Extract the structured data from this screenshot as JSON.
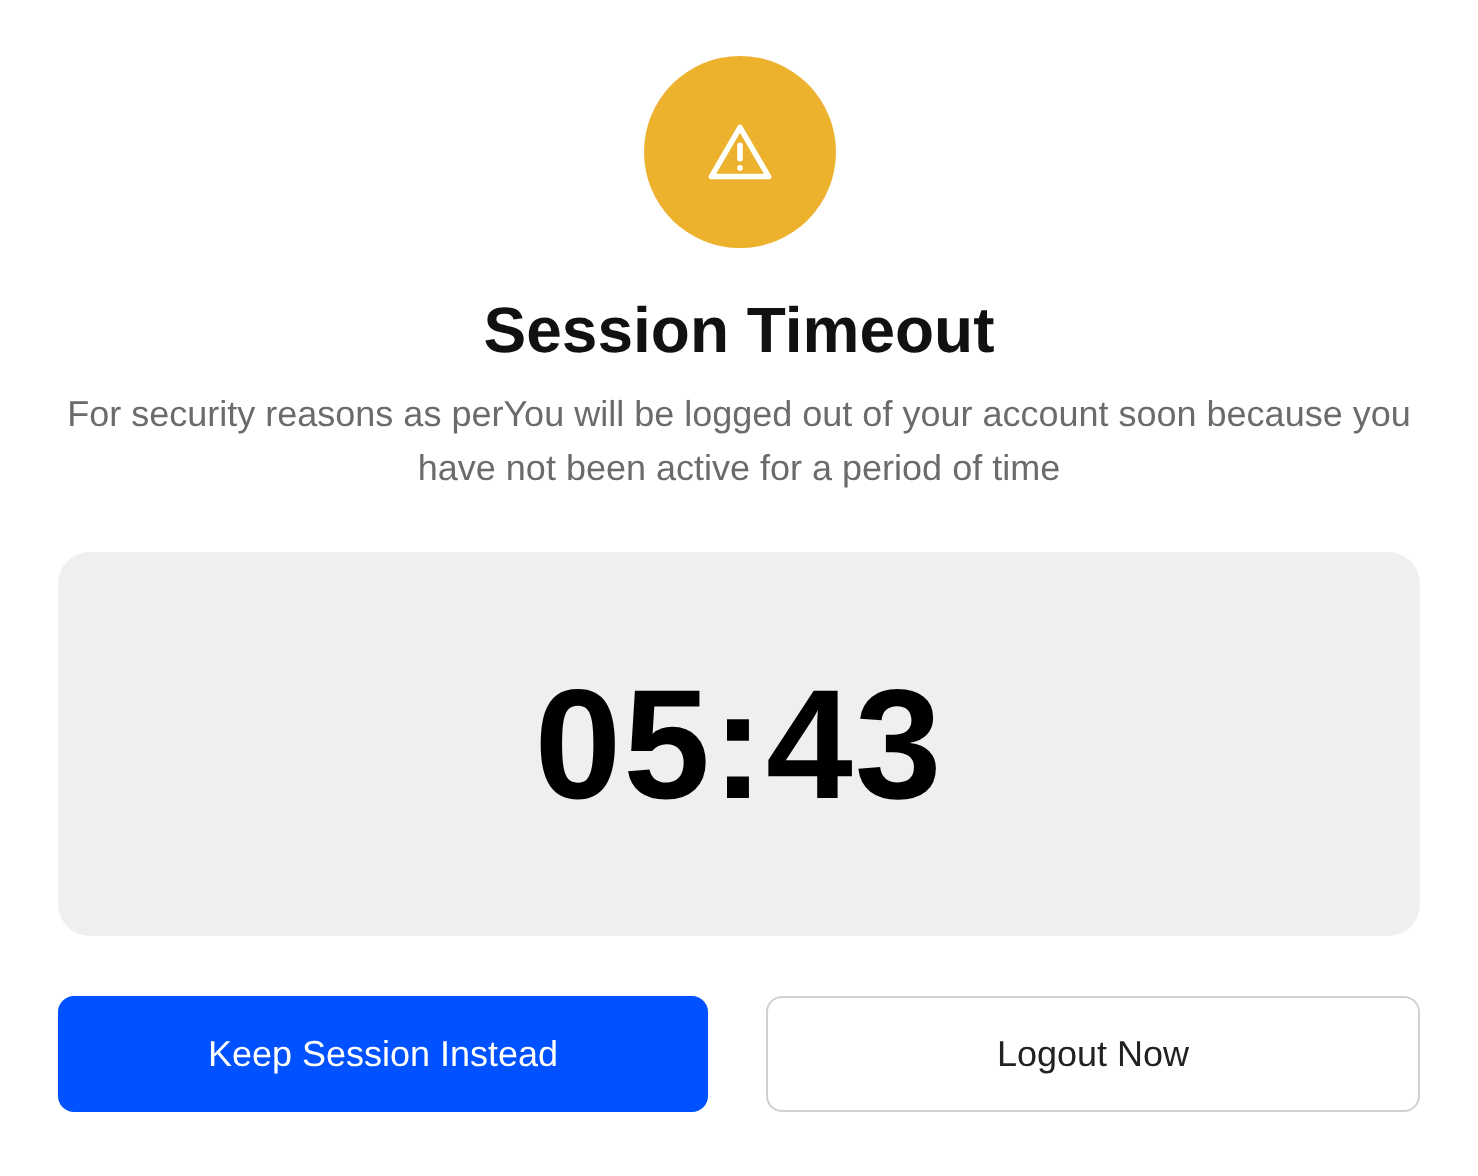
{
  "dialog": {
    "title": "Session Timeout",
    "message": "For security reasons as perYou will be logged out of your account soon because you have not been active for a period of time",
    "countdown": "05:43",
    "buttons": [
      {
        "label": "Keep Session Instead",
        "kind": "primary"
      },
      {
        "label": "Logout Now",
        "kind": "secondary"
      }
    ]
  }
}
